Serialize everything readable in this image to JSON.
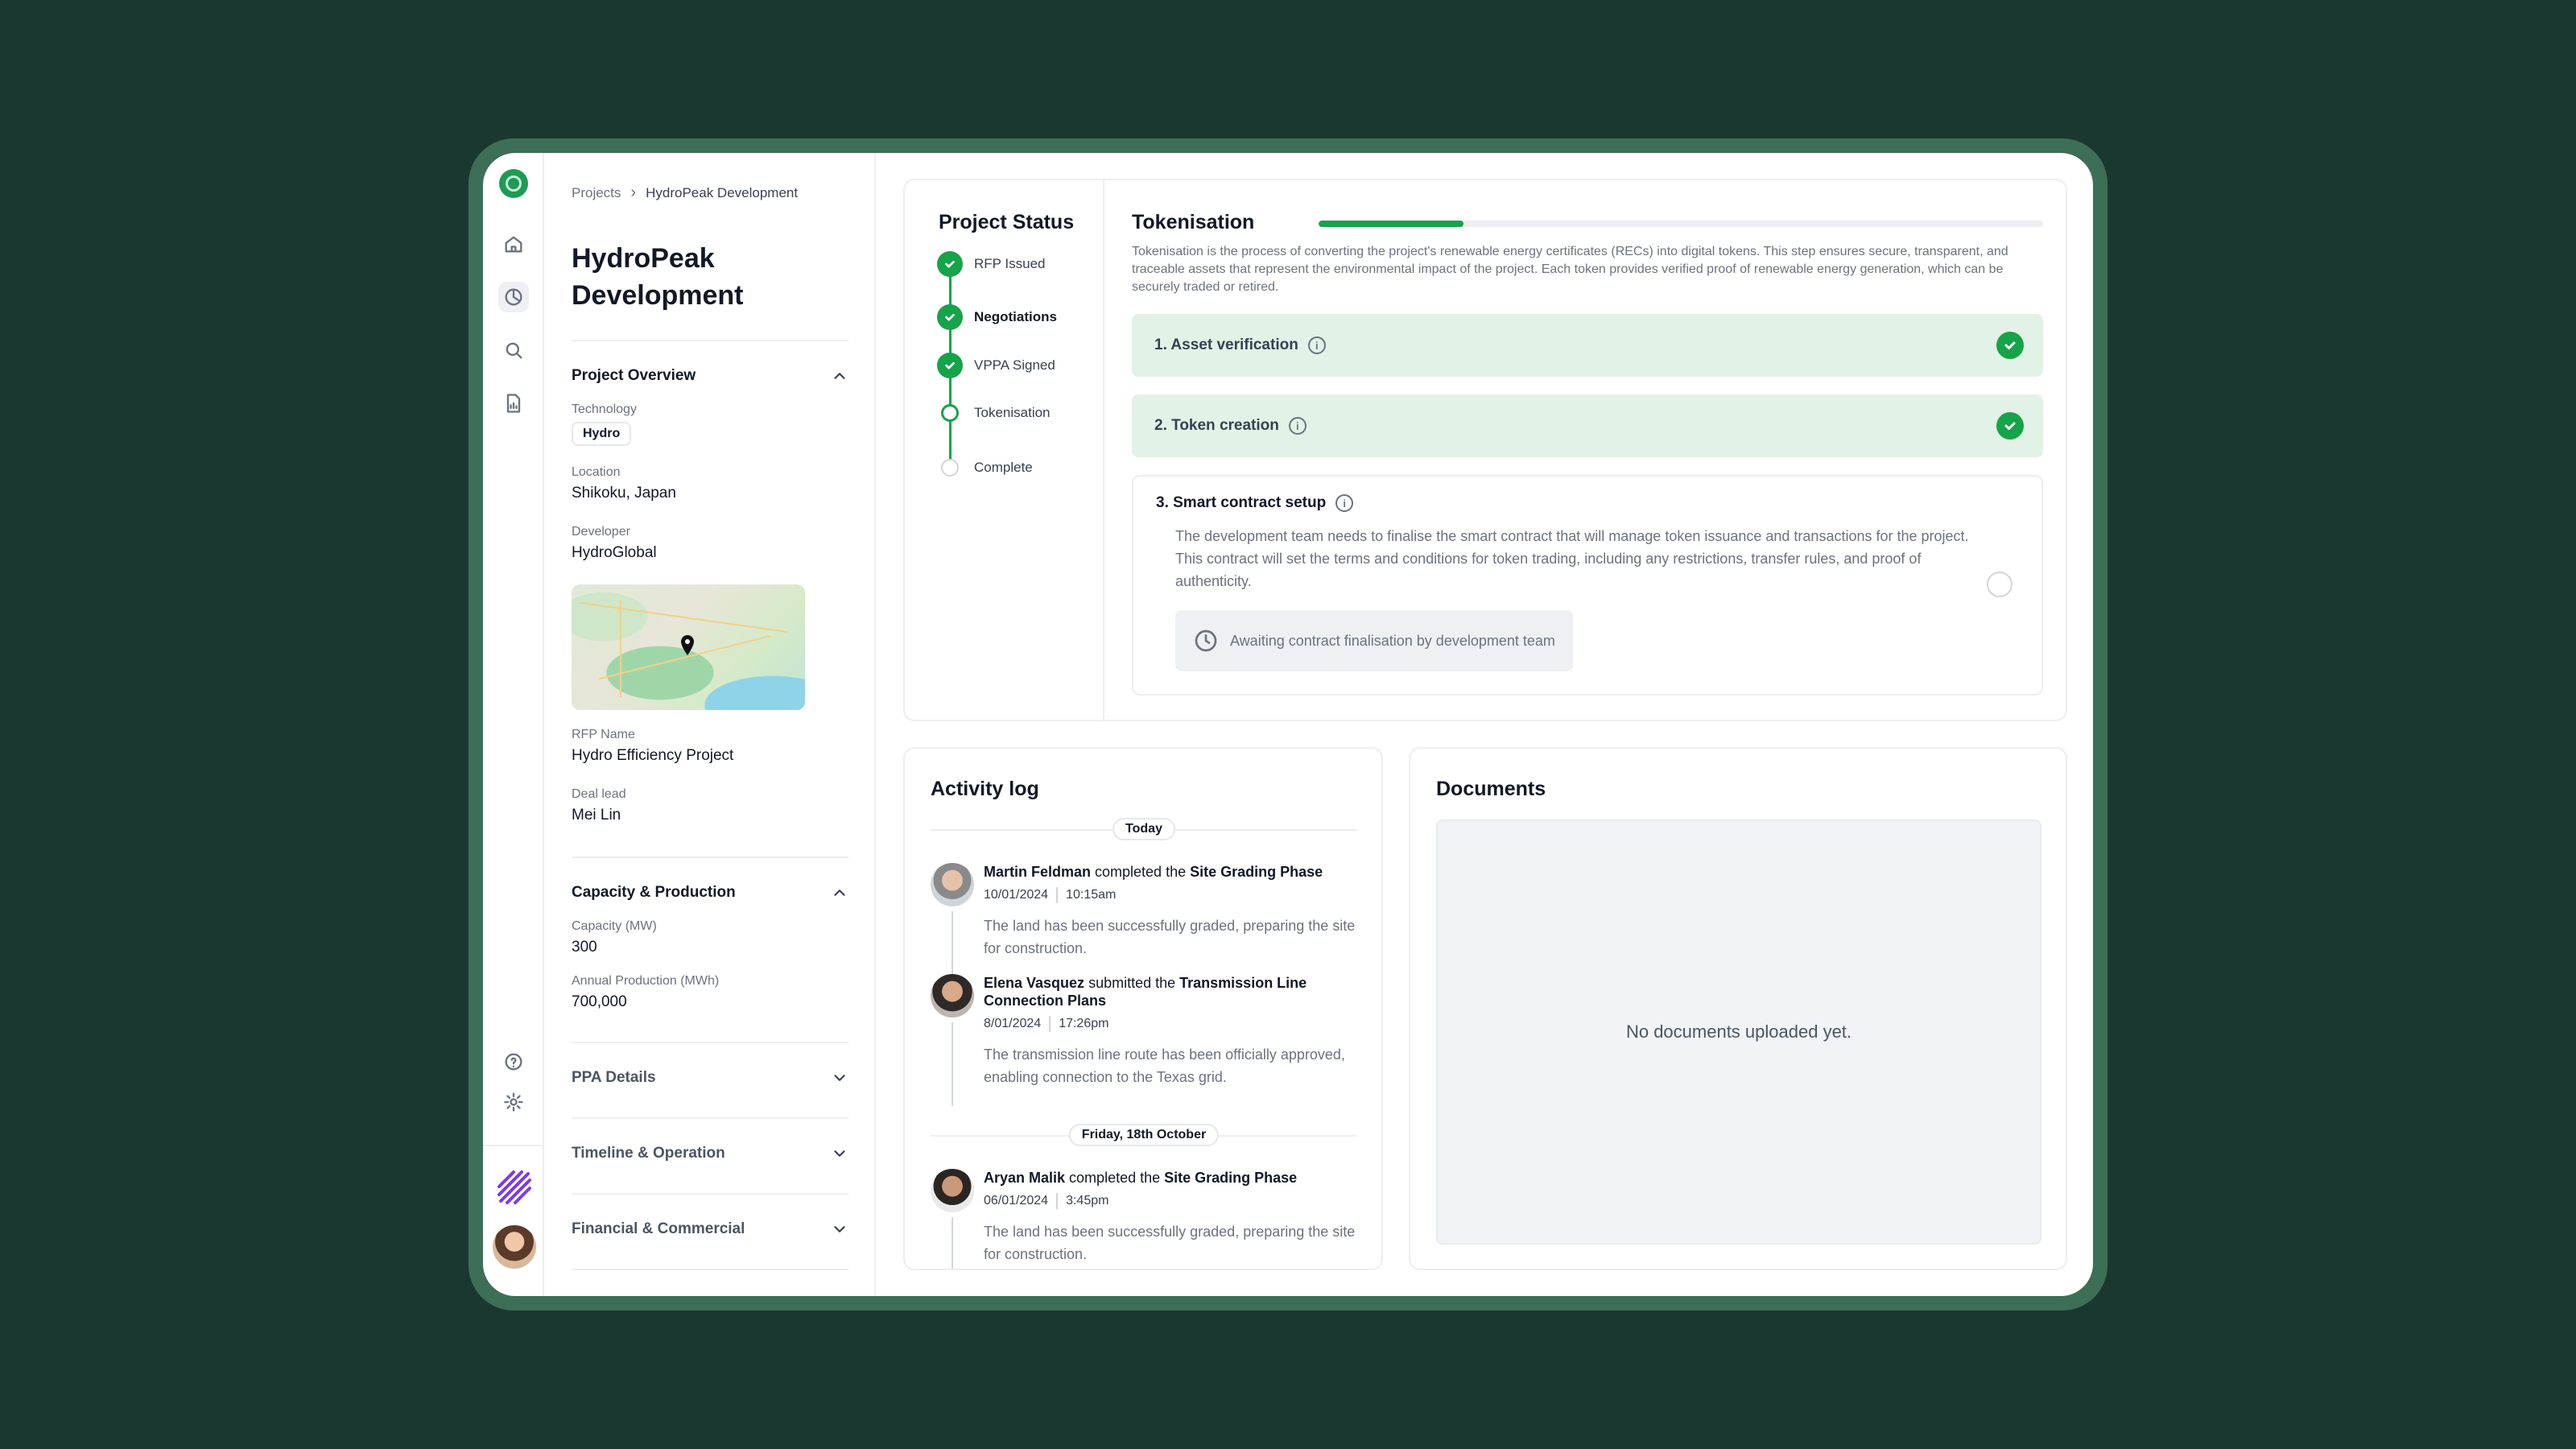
{
  "breadcrumb": {
    "root": "Projects",
    "current": "HydroPeak Development"
  },
  "project": {
    "title": "HydroPeak Development"
  },
  "overview": {
    "heading": "Project Overview",
    "technology_label": "Technology",
    "technology_value": "Hydro",
    "location_label": "Location",
    "location_value": "Shikoku, Japan",
    "developer_label": "Developer",
    "developer_value": "HydroGlobal",
    "rfp_label": "RFP Name",
    "rfp_value": "Hydro Efficiency Project",
    "deal_label": "Deal lead",
    "deal_value": "Mei Lin"
  },
  "capacity": {
    "heading": "Capacity & Production",
    "capacity_label": "Capacity (MW)",
    "capacity_value": "300",
    "production_label": "Annual Production (MWh)",
    "production_value": "700,000"
  },
  "collapsed_sections": [
    "PPA Details",
    "Timeline & Operation",
    "Financial & Commercial"
  ],
  "status": {
    "title": "Project Status",
    "steps": [
      {
        "label": "RFP Issued",
        "state": "done"
      },
      {
        "label": "Negotiations",
        "state": "done"
      },
      {
        "label": "VPPA Signed",
        "state": "done"
      },
      {
        "label": "Tokenisation",
        "state": "current"
      },
      {
        "label": "Complete",
        "state": "pending"
      }
    ]
  },
  "tokenisation": {
    "title": "Tokenisation",
    "progress": 0.2,
    "description": "Tokenisation is the process of converting the project's renewable energy certificates (RECs) into digital tokens. This step ensures secure, transparent, and traceable assets that represent the environmental impact of the project. Each token provides verified proof of renewable energy generation, which can be securely traded or retired.",
    "step1": "1. Asset verification",
    "step2": "2. Token creation",
    "step3": "3. Smart contract setup",
    "step3_desc": "The development team needs to finalise the smart contract that will manage token issuance and transactions for the project. This contract will set the terms and conditions for token trading, including any restrictions, transfer rules, and proof of authenticity.",
    "awaiting": "Awaiting contract finalisation by development team"
  },
  "activity": {
    "title": "Activity log",
    "groups": [
      {
        "day": "Today",
        "entries": [
          {
            "name": "Martin Feldman",
            "action": " completed the ",
            "object": "Site Grading Phase",
            "date": "10/01/2024",
            "time": "10:15am",
            "message": "The land has been successfully graded, preparing the site for construction."
          },
          {
            "name": "Elena Vasquez",
            "action": " submitted the ",
            "object": "Transmission Line Connection Plans",
            "date": "8/01/2024",
            "time": "17:26pm",
            "message": "The transmission line route has been officially approved, enabling connection to the Texas grid."
          }
        ]
      },
      {
        "day": "Friday, 18th October",
        "entries": [
          {
            "name": "Aryan Malik",
            "action": " completed the ",
            "object": "Site Grading Phase",
            "date": "06/01/2024",
            "time": "3:45pm",
            "message": "The land has been successfully graded, preparing the site for construction."
          }
        ]
      }
    ]
  },
  "documents": {
    "title": "Documents",
    "empty": "No documents uploaded yet."
  },
  "colors": {
    "accent": "#16a34a",
    "done_bg": "#e2f2e6",
    "frame": "#3d6e56",
    "background": "#1a3830"
  }
}
